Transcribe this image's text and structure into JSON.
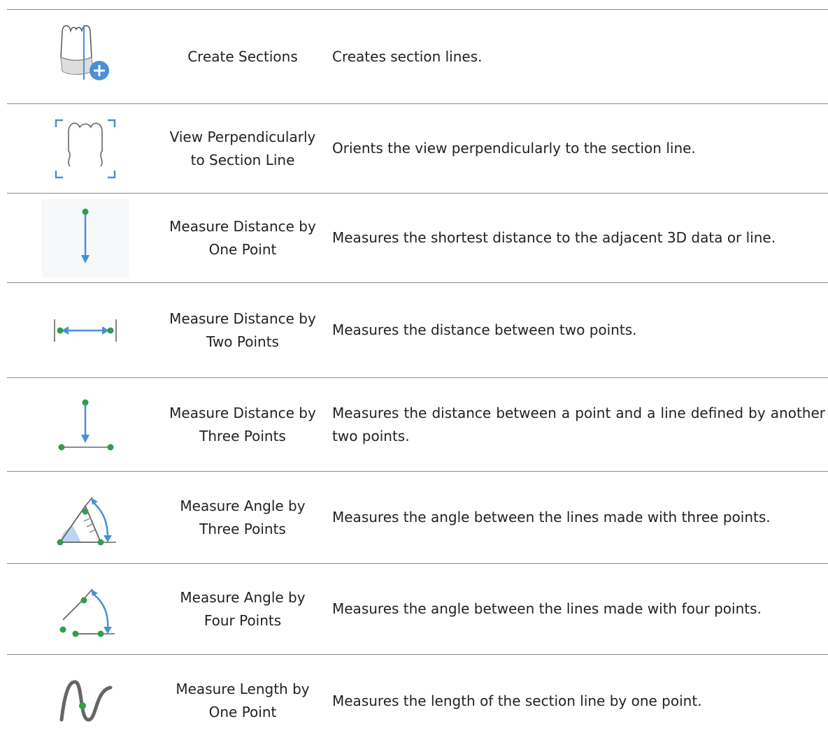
{
  "rows": [
    {
      "name": "Create Sections",
      "description": "Creates section lines.",
      "icon": "create-sections-icon"
    },
    {
      "name": "View Perpendicularly to Section Line",
      "description": "Orients the view perpendicularly to the section line.",
      "icon": "view-perpendicular-icon"
    },
    {
      "name": "Measure Distance by One Point",
      "description": "Measures the shortest distance to the adjacent 3D data or line.",
      "icon": "measure-distance-one-point-icon"
    },
    {
      "name": "Measure Distance by Two Points",
      "description": "Measures the distance between two points.",
      "icon": "measure-distance-two-points-icon"
    },
    {
      "name": "Measure Distance by Three Points",
      "description": "Measures the distance between a point and a line defined by another two points.",
      "icon": "measure-distance-three-points-icon"
    },
    {
      "name": "Measure Angle by Three Points",
      "description": "Measures the angle between the lines made with three points.",
      "icon": "measure-angle-three-points-icon"
    },
    {
      "name": "Measure Angle by Four Points",
      "description": "Measures the angle between the lines made with four points.",
      "icon": "measure-angle-four-points-icon"
    },
    {
      "name": "Measure Length by One Point",
      "description": "Measures the length of the section line by one point.",
      "icon": "measure-length-one-point-icon"
    }
  ],
  "colors": {
    "accent_blue": "#4a8fd8",
    "point_green": "#2e9e4f",
    "line_gray": "#666666"
  }
}
